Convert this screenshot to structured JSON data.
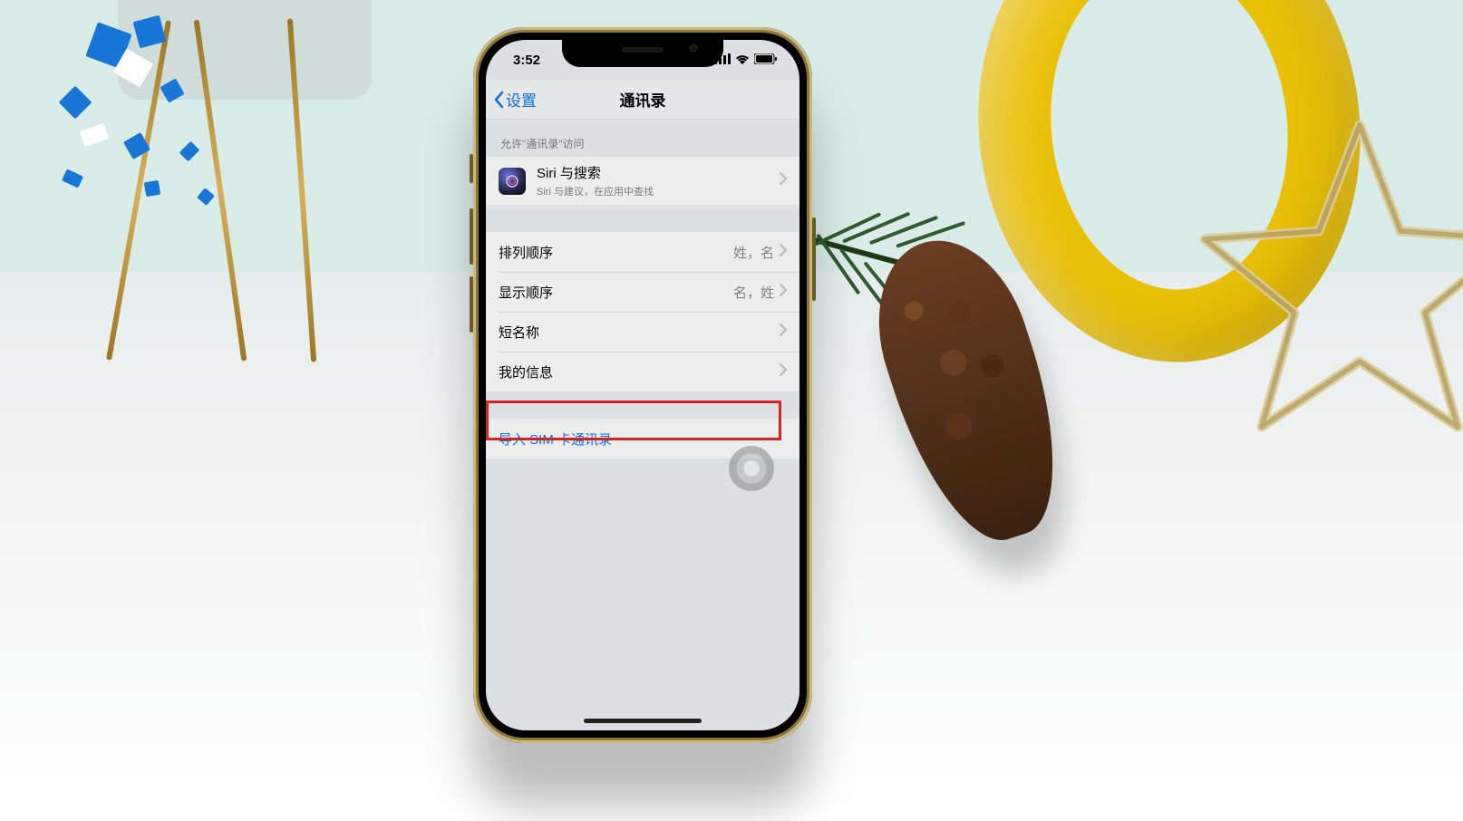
{
  "status_bar": {
    "time": "3:52"
  },
  "nav": {
    "back_label": "设置",
    "title": "通讯录"
  },
  "section1": {
    "header": "允许\"通讯录\"访问",
    "siri": {
      "title": "Siri 与搜索",
      "subtitle": "Siri 与建议，在应用中查找"
    }
  },
  "section2": {
    "sort_order_label": "排列顺序",
    "sort_order_value": "姓，名",
    "display_order_label": "显示顺序",
    "display_order_value": "名，姓",
    "short_name_label": "短名称",
    "my_info_label": "我的信息"
  },
  "section3": {
    "import_sim_label": "导入 SIM 卡通讯录"
  }
}
